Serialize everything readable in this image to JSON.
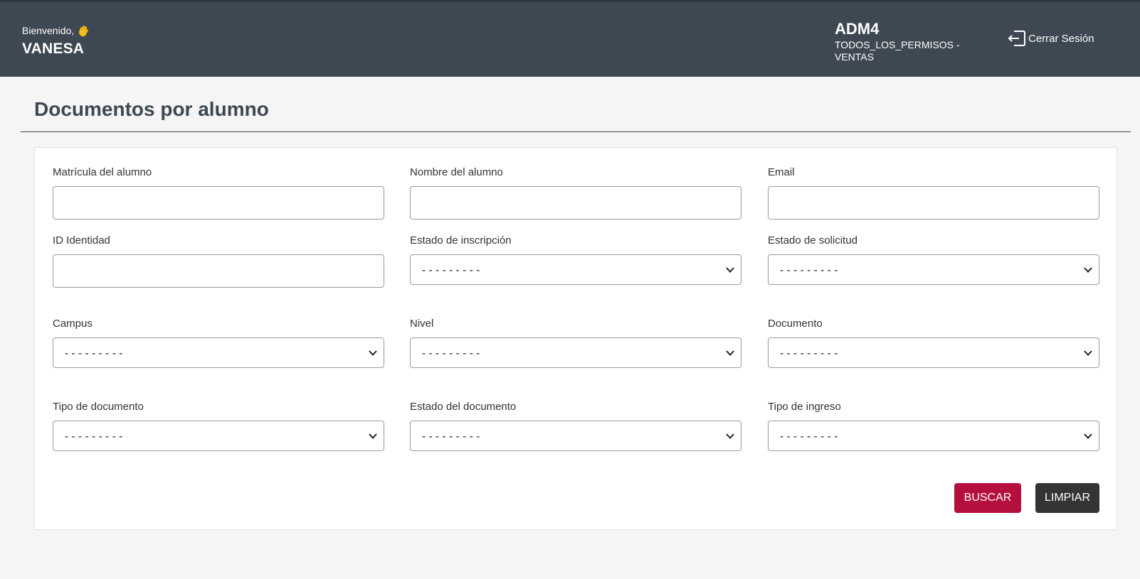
{
  "header": {
    "welcome": "Bienvenido,",
    "wave_icon": "waving-hand-icon",
    "username": "VANESA",
    "role_code": "ADM4",
    "role_desc": "TODOS_LOS_PERMISOS - VENTAS",
    "logout_label": "Cerrar Sesión",
    "logout_icon": "logout-icon",
    "bg_color": "#3e4852"
  },
  "page": {
    "title": "Documentos por alumno"
  },
  "form": {
    "matricula": {
      "label": "Matrícula del alumno",
      "value": ""
    },
    "nombre": {
      "label": "Nombre del alumno",
      "value": ""
    },
    "email": {
      "label": "Email",
      "value": ""
    },
    "id_identidad": {
      "label": "ID Identidad",
      "value": ""
    },
    "estado_inscripcion": {
      "label": "Estado de inscripción",
      "selected": "---------"
    },
    "estado_solicitud": {
      "label": "Estado de solicitud",
      "selected": "---------"
    },
    "campus": {
      "label": "Campus",
      "selected": "---------"
    },
    "nivel": {
      "label": "Nivel",
      "selected": "---------"
    },
    "documento": {
      "label": "Documento",
      "selected": "---------"
    },
    "tipo_documento": {
      "label": "Tipo de documento",
      "selected": "---------"
    },
    "estado_documento": {
      "label": "Estado del documento",
      "selected": "---------"
    },
    "tipo_ingreso": {
      "label": "Tipo de ingreso",
      "selected": "---------"
    }
  },
  "actions": {
    "search_label": "BUSCAR",
    "clear_label": "LIMPIAR",
    "search_color": "#b5103d",
    "clear_color": "#343434"
  }
}
